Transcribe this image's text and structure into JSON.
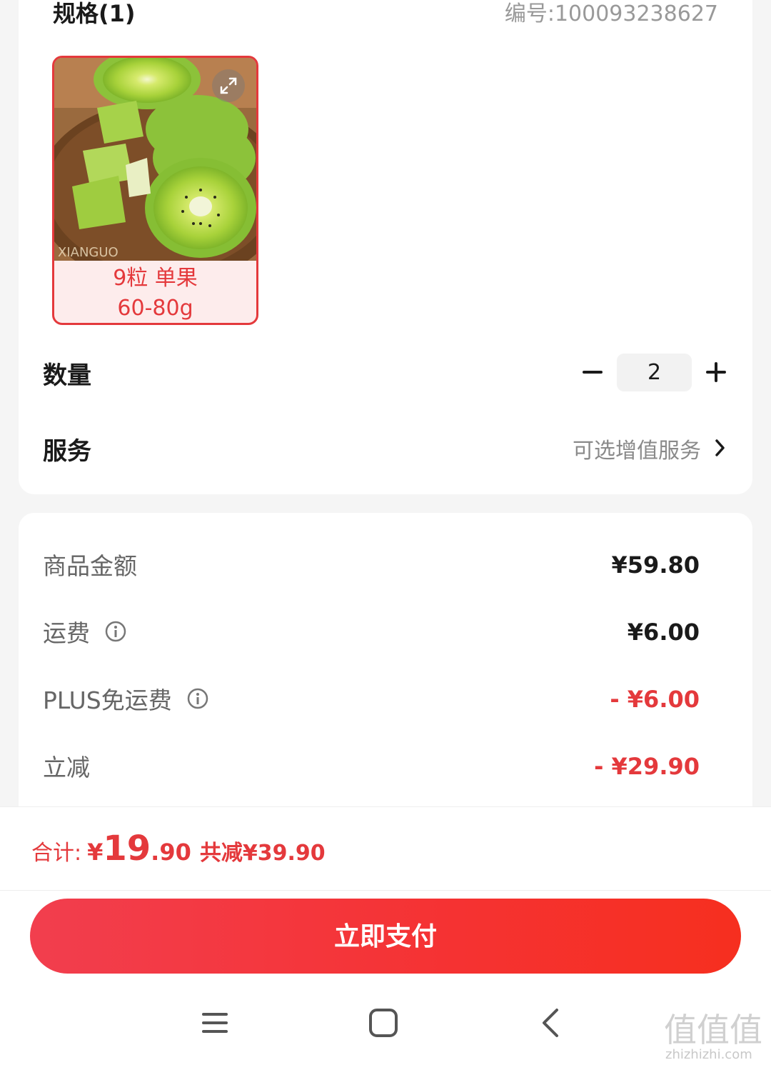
{
  "spec": {
    "title": "规格(1)",
    "sku_number": "编号:100093238627",
    "option": {
      "line1": "9粒 单果",
      "line2": "60-80g",
      "selected": true
    }
  },
  "quantity": {
    "label": "数量",
    "value": "2"
  },
  "service": {
    "label": "服务",
    "value": "可选增值服务"
  },
  "fees": {
    "goods": {
      "label": "商品金额",
      "value": "¥59.80"
    },
    "shipping": {
      "label": "运费",
      "value": "¥6.00"
    },
    "plus_free_shipping": {
      "label": "PLUS免运费",
      "value": "- ¥6.00"
    },
    "instant_discount": {
      "label": "立减",
      "value": "- ¥29.90"
    }
  },
  "summary": {
    "label": "合计:",
    "currency": "¥",
    "amount_int": "19",
    "amount_dec": ".90",
    "saved": "共减¥39.90"
  },
  "pay_button": {
    "label": "立即支付"
  },
  "watermark": {
    "site": "zhizhizhi.com",
    "logo_text": "值值值"
  },
  "colors": {
    "accent": "#e4393c",
    "button_start": "#f23e4e",
    "button_end": "#f62f1f"
  },
  "icons": [
    "expand-icon",
    "minus-icon",
    "plus-icon",
    "chevron-right-icon",
    "info-icon",
    "menu-icon",
    "home-icon",
    "back-icon"
  ]
}
